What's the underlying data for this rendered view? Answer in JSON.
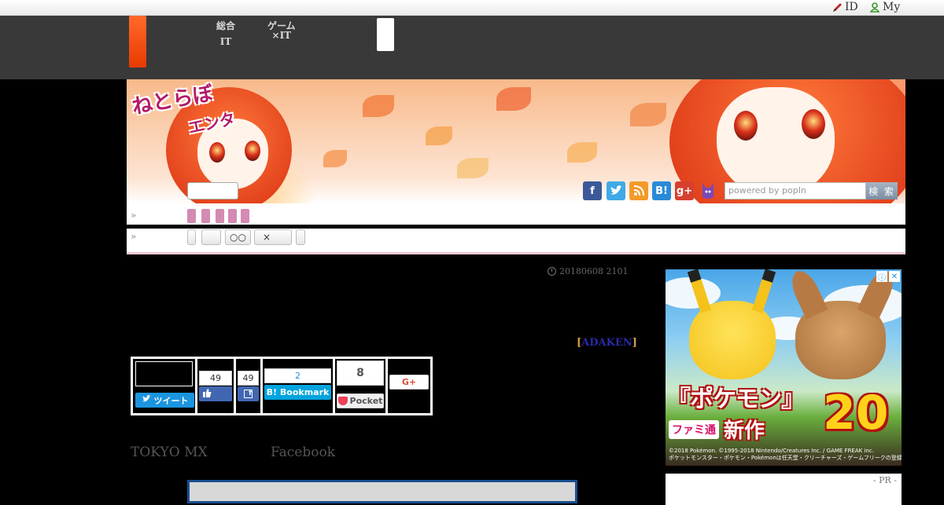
{
  "topbar": {
    "id_link": "ID",
    "my_link": "My"
  },
  "nav": {
    "item1": {
      "line1": "総合",
      "line2": "IT"
    },
    "item2": {
      "line1": "ゲーム",
      "line2": "×IT"
    }
  },
  "banner": {
    "logo_line1": "ねとらぼ",
    "logo_line2": "エンタ",
    "search_placeholder": "powered by popIn",
    "search_button": "検 索",
    "social_icons": [
      "facebook-icon",
      "twitter-icon",
      "rss-icon",
      "hatena-bookmark-icon",
      "google-plus-icon",
      "cat-mascot-icon"
    ]
  },
  "breadcrumb_rows": {
    "row1_marker": "»",
    "row2_marker": "»",
    "row2_buttons": [
      "",
      "",
      "○○",
      "×",
      ""
    ]
  },
  "article": {
    "date": "20180608 2101",
    "credit_open": "[",
    "credit_link": "ADAKEN",
    "credit_close": "]",
    "line_left": "TOKYO MX",
    "line_right": "Facebook"
  },
  "share": {
    "tweet_label": "ツイート",
    "like_count": "49",
    "fb_share_count": "49",
    "hatena_count": "2",
    "hatena_label": "B! Bookmark",
    "pocket_count": "8",
    "pocket_label": "Pocket",
    "gplus_label": "G+"
  },
  "ad": {
    "title": "『ポケモン』",
    "famitsu": "ファミ通",
    "new_label": "新作",
    "big_number": "20",
    "copyright1": "©2018 Pokémon. ©1995-2018 Nintendo/Creatures Inc. / GAME FREAK inc.",
    "copyright2": "ポケットモンスター・ポケモン・Pokémonは任天堂・クリーチャーズ・ゲームフリークの登録商標です。",
    "info_icon": "ⓘ",
    "close_icon": "✕"
  },
  "pr": {
    "label": "- PR -"
  }
}
